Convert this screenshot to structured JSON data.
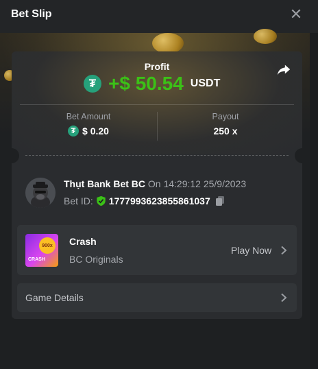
{
  "header": {
    "title": "Bet Slip",
    "close_icon": "close-icon"
  },
  "profit": {
    "label": "Profit",
    "value": "+$ 50.54",
    "currency": "USDT",
    "currency_icon": "tether-icon",
    "value_color": "#3bc117"
  },
  "stats": {
    "bet_amount_label": "Bet Amount",
    "bet_amount_value": "$ 0.20",
    "payout_label": "Payout",
    "payout_value": "250 x"
  },
  "player": {
    "name": "Thụt Bank Bet BC",
    "time": "On 14:29:12 25/9/2023",
    "bet_id_label": "Bet ID:",
    "bet_id": "1777993623855861037"
  },
  "game": {
    "name": "Crash",
    "provider": "BC Originals",
    "play_label": "Play Now",
    "thumb_text": "CRASH",
    "thumb_badge": "900x"
  },
  "details": {
    "label": "Game Details"
  },
  "colors": {
    "accent_green": "#3bc117",
    "tether": "#26a17b",
    "background": "#1e2022",
    "card": "#2a2c2f"
  }
}
